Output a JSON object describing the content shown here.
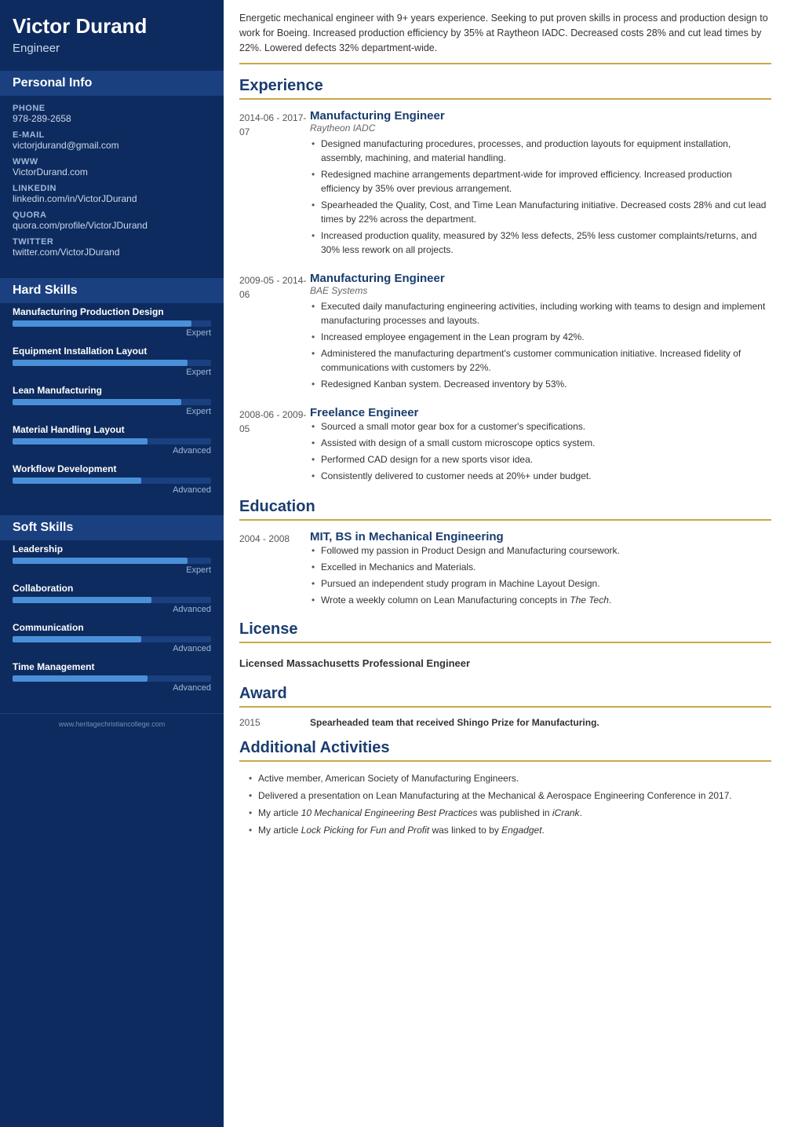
{
  "sidebar": {
    "name": "Victor Durand",
    "title": "Engineer",
    "personal_info_heading": "Personal Info",
    "personal": [
      {
        "label": "Phone",
        "value": "978-289-2658"
      },
      {
        "label": "E-mail",
        "value": "victorjdurand@gmail.com"
      },
      {
        "label": "WWW",
        "value": "VictorDurand.com"
      },
      {
        "label": "LinkedIn",
        "value": "linkedin.com/in/VictorJDurand"
      },
      {
        "label": "Quora",
        "value": "quora.com/profile/VictorJDurand"
      },
      {
        "label": "Twitter",
        "value": "twitter.com/VictorJDurand"
      }
    ],
    "hard_skills_heading": "Hard Skills",
    "hard_skills": [
      {
        "name": "Manufacturing Production Design",
        "level": "Expert",
        "pct": 90
      },
      {
        "name": "Equipment Installation Layout",
        "level": "Expert",
        "pct": 88
      },
      {
        "name": "Lean Manufacturing",
        "level": "Expert",
        "pct": 85
      },
      {
        "name": "Material Handling Layout",
        "level": "Advanced",
        "pct": 68
      },
      {
        "name": "Workflow Development",
        "level": "Advanced",
        "pct": 65
      }
    ],
    "soft_skills_heading": "Soft Skills",
    "soft_skills": [
      {
        "name": "Leadership",
        "level": "Expert",
        "pct": 88
      },
      {
        "name": "Collaboration",
        "level": "Advanced",
        "pct": 70
      },
      {
        "name": "Communication",
        "level": "Advanced",
        "pct": 65
      },
      {
        "name": "Time Management",
        "level": "Advanced",
        "pct": 68
      }
    ],
    "footer": "www.heritagechristiancollege.com"
  },
  "main": {
    "summary": "Energetic mechanical engineer with 9+ years experience. Seeking to put proven skills in process and production design to work for Boeing. Increased production efficiency by 35% at Raytheon IADC. Decreased costs 28% and cut lead times by 22%. Lowered defects 32% department-wide.",
    "experience_heading": "Experience",
    "experience": [
      {
        "date": "2014-06 - 2017-07",
        "title": "Manufacturing Engineer",
        "company": "Raytheon IADC",
        "bullets": [
          "Designed manufacturing procedures, processes, and production layouts for equipment installation, assembly, machining, and material handling.",
          "Redesigned machine arrangements department-wide for improved efficiency. Increased production efficiency by 35% over previous arrangement.",
          "Spearheaded the Quality, Cost, and Time Lean Manufacturing initiative. Decreased costs 28% and cut lead times by 22% across the department.",
          "Increased production quality, measured by 32% less defects, 25% less customer complaints/returns, and 30% less rework on all projects."
        ]
      },
      {
        "date": "2009-05 - 2014-06",
        "title": "Manufacturing Engineer",
        "company": "BAE Systems",
        "bullets": [
          "Executed daily manufacturing engineering activities, including working with teams to design and implement manufacturing processes and layouts.",
          "Increased employee engagement in the Lean program by 42%.",
          "Administered the manufacturing department's customer communication initiative. Increased fidelity of communications with customers by 22%.",
          "Redesigned Kanban system. Decreased inventory by 53%."
        ]
      },
      {
        "date": "2008-06 - 2009-05",
        "title": "Freelance Engineer",
        "company": "",
        "bullets": [
          "Sourced a small motor gear box for a customer's specifications.",
          "Assisted with design of a small custom microscope optics system.",
          "Performed CAD design for a new sports visor idea.",
          "Consistently delivered to customer needs at 20%+ under budget."
        ]
      }
    ],
    "education_heading": "Education",
    "education": [
      {
        "date": "2004 - 2008",
        "degree": "MIT, BS in Mechanical Engineering",
        "bullets": [
          "Followed my passion in Product Design and Manufacturing coursework.",
          "Excelled in Mechanics and Materials.",
          "Pursued an independent study program in Machine Layout Design.",
          "Wrote a weekly column on Lean Manufacturing concepts in The Tech."
        ]
      }
    ],
    "license_heading": "License",
    "license": "Licensed Massachusetts Professional Engineer",
    "award_heading": "Award",
    "award_year": "2015",
    "award_text": "Spearheaded team that received Shingo Prize for Manufacturing.",
    "activities_heading": "Additional Activities",
    "activities": [
      "Active member, American Society of Manufacturing Engineers.",
      "Delivered a presentation on Lean Manufacturing at the Mechanical & Aerospace Engineering Conference in 2017.",
      "My article 10 Mechanical Engineering Best Practices was published in iCrank.",
      "My article Lock Picking for Fun and Profit was linked to by Engadget."
    ]
  }
}
